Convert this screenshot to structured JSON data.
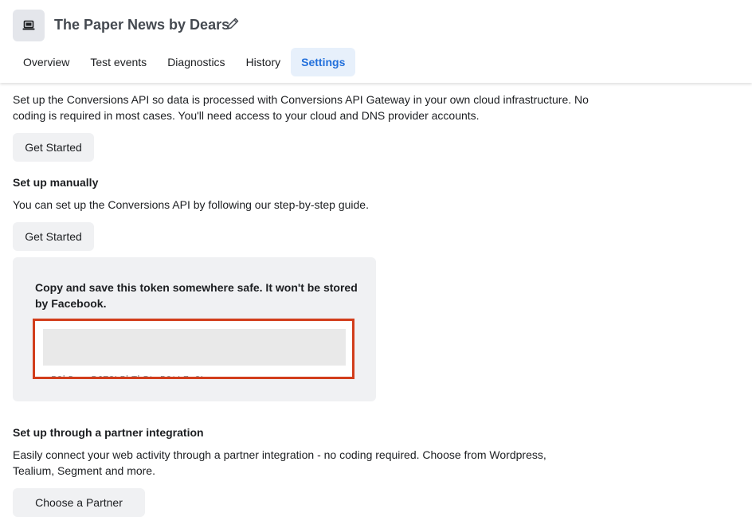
{
  "header": {
    "title": "The Paper News by Dears",
    "app_icon": "laptop-icon",
    "edit_icon": "pencil-icon",
    "tabs": [
      {
        "label": "Overview",
        "active": false
      },
      {
        "label": "Test events",
        "active": false
      },
      {
        "label": "Diagnostics",
        "active": false
      },
      {
        "label": "History",
        "active": false
      },
      {
        "label": "Settings",
        "active": true
      }
    ]
  },
  "gateway_section": {
    "description": "Set up the Conversions API so data is processed with Conversions API Gateway in your own cloud infrastructure. No coding is required in most cases. You'll need access to your cloud and DNS provider accounts.",
    "button_label": "Get Started"
  },
  "manual_section": {
    "heading": "Set up manually",
    "description": "You can set up the Conversions API by following our step-by-step guide.",
    "button_label": "Get Started"
  },
  "token_card": {
    "instruction": "Copy and save this token somewhere safe. It won't be stored by Facebook.",
    "token_partial": "EAAE0dbxjfoBAMyUI0B0YKZ8xkOv01mZ4hOKxUOskJzeqEBM e1azB0bDyszBJZCLRhTbItzB0tL7pCL"
  },
  "partner_section": {
    "heading": "Set up through a partner integration",
    "description": "Easily connect your web activity through a partner integration - no coding required. Choose from Wordpress, Tealium, Segment and more.",
    "button_label": "Choose a Partner"
  },
  "colors": {
    "accent": "#216fdb",
    "tab_active_bg": "#e7f0fb",
    "highlight_border": "#d23d1b",
    "button_bg": "#f0f1f3"
  }
}
